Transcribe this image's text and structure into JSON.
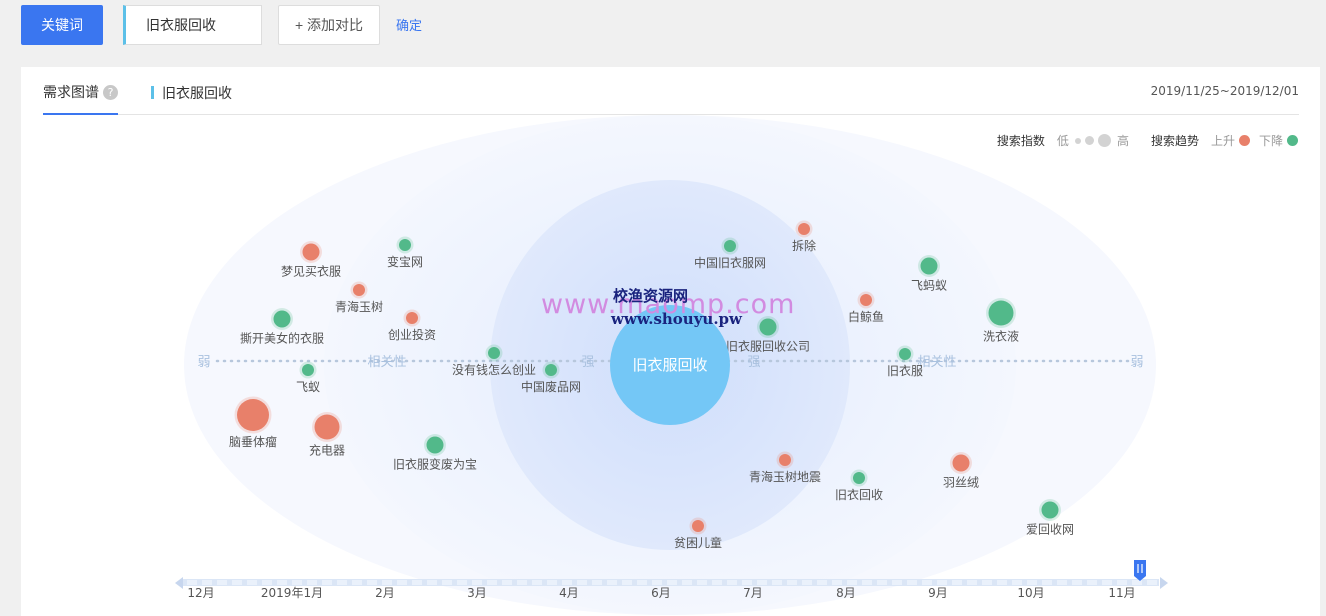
{
  "toolbar": {
    "keyword_button": "关键词",
    "keyword_value": "旧衣服回收",
    "add_compare": "+ 添加对比",
    "confirm": "确定"
  },
  "card": {
    "tab_title": "需求图谱",
    "help_icon": "?",
    "keyword_tab": "旧衣服回收",
    "date_range": "2019/11/25~2019/12/01"
  },
  "legend": {
    "index_label": "搜索指数",
    "low": "低",
    "high": "高",
    "trend_label": "搜索趋势",
    "up": "上升",
    "down": "下降",
    "up_color": "#e8806a",
    "down_color": "#52b98a"
  },
  "axis": {
    "weak": "弱",
    "relevance": "相关性",
    "strong": "强"
  },
  "center": {
    "label": "旧衣服回收",
    "color": "#74c7f6"
  },
  "nodes": [
    {
      "label": "梦见买衣服",
      "trend": "up",
      "size": "m"
    },
    {
      "label": "变宝网",
      "trend": "down",
      "size": "s"
    },
    {
      "label": "青海玉树",
      "trend": "up",
      "size": "s"
    },
    {
      "label": "撕开美女的衣服",
      "trend": "down",
      "size": "m"
    },
    {
      "label": "创业投资",
      "trend": "up",
      "size": "s"
    },
    {
      "label": "飞蚁",
      "trend": "down",
      "size": "s"
    },
    {
      "label": "没有钱怎么创业",
      "trend": "down",
      "size": "s"
    },
    {
      "label": "中国废品网",
      "trend": "down",
      "size": "s"
    },
    {
      "label": "脑垂体瘤",
      "trend": "up",
      "size": "xl"
    },
    {
      "label": "充电器",
      "trend": "up",
      "size": "l"
    },
    {
      "label": "旧衣服变废为宝",
      "trend": "down",
      "size": "m"
    },
    {
      "label": "中国旧衣服网",
      "trend": "down",
      "size": "s"
    },
    {
      "label": "拆除",
      "trend": "up",
      "size": "s"
    },
    {
      "label": "飞蚂蚁",
      "trend": "down",
      "size": "m"
    },
    {
      "label": "白鲸鱼",
      "trend": "up",
      "size": "s"
    },
    {
      "label": "旧衣服回收公司",
      "trend": "down",
      "size": "m"
    },
    {
      "label": "洗衣液",
      "trend": "down",
      "size": "l"
    },
    {
      "label": "旧衣服",
      "trend": "down",
      "size": "s"
    },
    {
      "label": "青海玉树地震",
      "trend": "up",
      "size": "s"
    },
    {
      "label": "旧衣回收",
      "trend": "down",
      "size": "s"
    },
    {
      "label": "羽丝绒",
      "trend": "up",
      "size": "m"
    },
    {
      "label": "爱回收网",
      "trend": "down",
      "size": "m"
    },
    {
      "label": "贫困儿童",
      "trend": "up",
      "size": "s"
    }
  ],
  "timeline": {
    "labels": [
      "12月",
      "2019年1月",
      "2月",
      "3月",
      "4月",
      "6月",
      "7月",
      "8月",
      "9月",
      "10月",
      "11月"
    ],
    "handle_icon": "handle-icon"
  },
  "watermark": {
    "site_cn": "校渔资源网",
    "url1": "www.maomp.com",
    "url2": "www.shouyu.pw"
  }
}
